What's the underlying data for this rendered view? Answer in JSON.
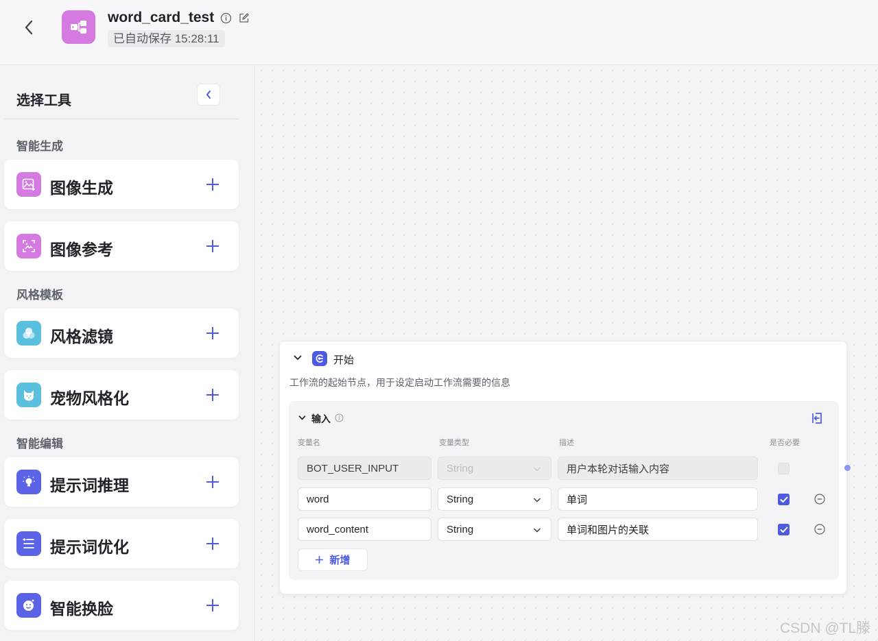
{
  "header": {
    "title": "word_card_test",
    "save_status": "已自动保存 15:28:11",
    "app_icon_color": "#d47ae0"
  },
  "sidebar": {
    "title": "选择工具",
    "sections": [
      {
        "label": "智能生成",
        "items": [
          {
            "label": "图像生成",
            "icon": "image-generate-icon",
            "color": "#d47ae0"
          },
          {
            "label": "图像参考",
            "icon": "image-reference-icon",
            "color": "#d47ae0"
          }
        ]
      },
      {
        "label": "风格模板",
        "items": [
          {
            "label": "风格滤镜",
            "icon": "style-filter-icon",
            "color": "#5bc0de"
          },
          {
            "label": "宠物风格化",
            "icon": "pet-style-icon",
            "color": "#5bc0de"
          }
        ]
      },
      {
        "label": "智能编辑",
        "items": [
          {
            "label": "提示词推理",
            "icon": "prompt-reasoning-icon",
            "color": "#5b63e6"
          },
          {
            "label": "提示词优化",
            "icon": "prompt-optimize-icon",
            "color": "#5b63e6"
          },
          {
            "label": "智能换脸",
            "icon": "face-swap-icon",
            "color": "#5b63e6"
          }
        ]
      }
    ]
  },
  "node": {
    "title": "开始",
    "description": "工作流的起始节点，用于设定启动工作流需要的信息",
    "panel": {
      "title": "输入",
      "columns": {
        "name": "变量名",
        "type": "变量类型",
        "desc": "描述",
        "required": "是否必要"
      },
      "rows": [
        {
          "name": "BOT_USER_INPUT",
          "type": "String",
          "desc": "用户本轮对话输入内容",
          "required": false,
          "locked": true
        },
        {
          "name": "word",
          "type": "String",
          "desc": "单词",
          "required": true,
          "locked": false
        },
        {
          "name": "word_content",
          "type": "String",
          "desc": "单词和图片的关联",
          "required": true,
          "locked": false
        }
      ],
      "add_label": "新增"
    }
  },
  "watermark": "CSDN @TL滕",
  "colors": {
    "accent": "#4e5be0"
  }
}
